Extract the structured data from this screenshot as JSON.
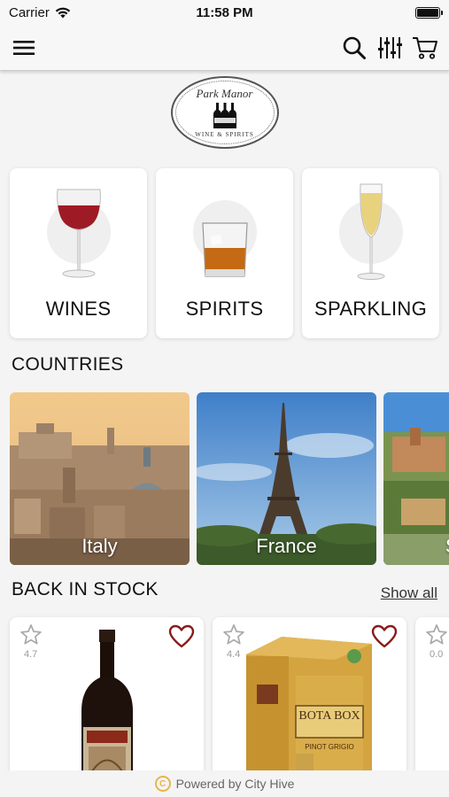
{
  "status_bar": {
    "carrier": "Carrier",
    "time": "11:58 PM"
  },
  "nav": {
    "menu_icon": "hamburger-menu-icon",
    "search_icon": "search-icon",
    "filter_icon": "filter-sliders-icon",
    "cart_icon": "cart-icon"
  },
  "logo": {
    "name": "Park Manor",
    "tagline": "WINE & SPIRITS"
  },
  "categories": [
    {
      "label": "WINES",
      "icon": "wine-glass-icon"
    },
    {
      "label": "SPIRITS",
      "icon": "whiskey-glass-icon"
    },
    {
      "label": "SPARKLING",
      "icon": "champagne-flute-icon"
    }
  ],
  "countries": {
    "title": "COUNTRIES",
    "items": [
      {
        "label": "Italy"
      },
      {
        "label": "France"
      },
      {
        "label": "S"
      }
    ]
  },
  "back_in_stock": {
    "title": "BACK IN STOCK",
    "show_all": "Show all",
    "products": [
      {
        "rating": "4.7",
        "favorite": false
      },
      {
        "rating": "4.4",
        "favorite": false
      },
      {
        "rating": "0.0",
        "favorite": false
      }
    ],
    "box_brand": "BOTA BOX",
    "box_variety": "PINOT GRIGIO"
  },
  "footer": {
    "text": "Powered by City Hive"
  },
  "colors": {
    "heart": "#8b1a1a",
    "footer_badge": "#e8b54c",
    "background": "#f4f4f4"
  }
}
